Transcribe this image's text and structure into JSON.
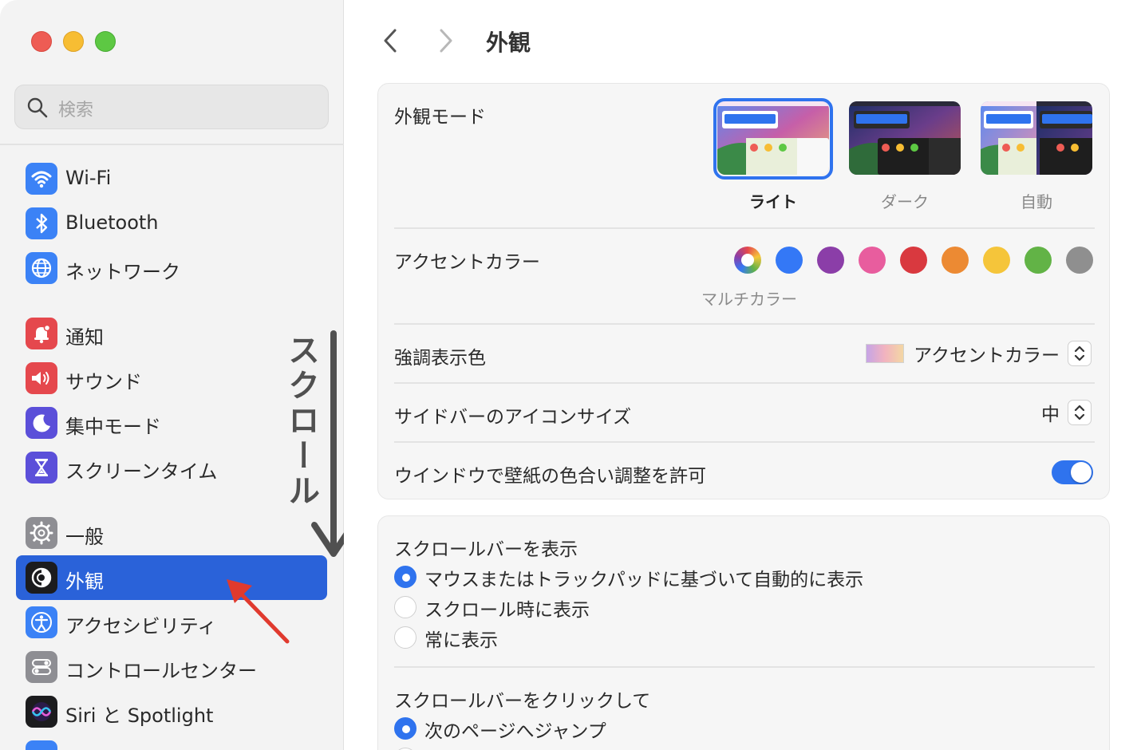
{
  "sidebar": {
    "search_placeholder": "検索",
    "items": [
      {
        "label": "Wi-Fi",
        "icon": "wifi-icon",
        "color": "#3b82f6"
      },
      {
        "label": "Bluetooth",
        "icon": "bluetooth-icon",
        "color": "#3b82f6"
      },
      {
        "label": "ネットワーク",
        "icon": "globe-icon",
        "color": "#3b82f6"
      },
      {
        "label": "通知",
        "icon": "bell-icon",
        "color": "#e5484d"
      },
      {
        "label": "サウンド",
        "icon": "speaker-icon",
        "color": "#e5484d"
      },
      {
        "label": "集中モード",
        "icon": "moon-icon",
        "color": "#5b4fd9"
      },
      {
        "label": "スクリーンタイム",
        "icon": "hourglass-icon",
        "color": "#5b4fd9"
      },
      {
        "label": "一般",
        "icon": "gear-icon",
        "color": "#8e8e93"
      },
      {
        "label": "外観",
        "icon": "appearance-icon",
        "color": "#1c1c1e"
      },
      {
        "label": "アクセシビリティ",
        "icon": "accessibility-icon",
        "color": "#3b82f6"
      },
      {
        "label": "コントロールセンター",
        "icon": "control-center-icon",
        "color": "#8e8e93"
      },
      {
        "label": "Siri と Spotlight",
        "icon": "siri-icon",
        "color": "#1c1c1e"
      }
    ]
  },
  "annotation": {
    "scroll_text": "スクロール"
  },
  "main": {
    "title": "外観",
    "appearance_mode": {
      "label": "外観モード",
      "options": [
        "ライト",
        "ダーク",
        "自動"
      ],
      "selected": "ライト"
    },
    "accent_color": {
      "label": "アクセントカラー",
      "caption": "マルチカラー",
      "colors": [
        "#3478f6",
        "#8b3ea8",
        "#e85d9e",
        "#d9393f",
        "#ec8a33",
        "#f5c53a",
        "#62b346",
        "#8f8f8f"
      ]
    },
    "highlight_color": {
      "label": "強調表示色",
      "value": "アクセントカラー"
    },
    "sidebar_icon_size": {
      "label": "サイドバーのアイコンサイズ",
      "value": "中"
    },
    "wallpaper_tint": {
      "label": "ウインドウで壁紙の色合い調整を許可",
      "on": true
    },
    "scrollbars": {
      "label": "スクロールバーを表示",
      "options": [
        "マウスまたはトラックパッドに基づいて自動的に表示",
        "スクロール時に表示",
        "常に表示"
      ],
      "selected": 0
    },
    "click_scrollbar": {
      "label": "スクロールバーをクリックして",
      "options": [
        "次のページへジャンプ"
      ],
      "selected": 0
    }
  }
}
